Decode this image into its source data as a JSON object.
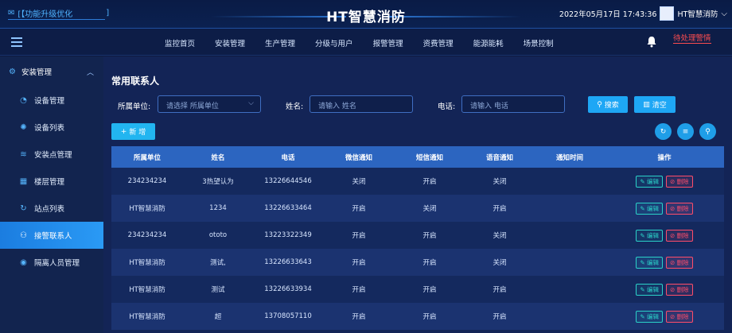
{
  "header": {
    "notice": "[【功能升级优化",
    "notice_bracket": "]",
    "title": "HT智慧消防",
    "datetime": "2022年05月17日 17:43:36",
    "user": "HT智慧消防"
  },
  "nav": {
    "items": [
      "监控首页",
      "安装管理",
      "生产管理",
      "分级与用户",
      "报警管理",
      "资费管理",
      "能源能耗",
      "场景控制"
    ],
    "alarm_link": "待处理警情"
  },
  "sidebar": {
    "group": "安装管理",
    "items": [
      {
        "label": "设备管理",
        "icon": "circle-icon"
      },
      {
        "label": "设备列表",
        "icon": "gear-icon"
      },
      {
        "label": "安装点管理",
        "icon": "layers-icon"
      },
      {
        "label": "楼层管理",
        "icon": "building-icon"
      },
      {
        "label": "站点列表",
        "icon": "refresh-icon"
      },
      {
        "label": "接警联系人",
        "icon": "user-icon"
      },
      {
        "label": "隔离人员管理",
        "icon": "eye-icon"
      }
    ],
    "active_index": 5
  },
  "main": {
    "title": "常用联系人",
    "filters": {
      "unit_label": "所属单位:",
      "unit_placeholder": "请选择 所属单位",
      "name_label": "姓名:",
      "name_placeholder": "请输入 姓名",
      "phone_label": "电话:",
      "phone_placeholder": "请输入 电话",
      "search_btn": "搜索",
      "clear_btn": "清空"
    },
    "add_btn": "新 增",
    "table": {
      "columns": [
        "所属单位",
        "姓名",
        "电话",
        "微信通知",
        "短信通知",
        "语音通知",
        "通知时间",
        "操作"
      ],
      "rows": [
        [
          "234234234",
          "3热望认为",
          "13226644546",
          "关闭",
          "开启",
          "关闭",
          ""
        ],
        [
          "HT智慧消防",
          "1234",
          "13226633464",
          "开启",
          "关闭",
          "开启",
          ""
        ],
        [
          "234234234",
          "ototo",
          "13223322349",
          "开启",
          "开启",
          "关闭",
          ""
        ],
        [
          "HT智慧消防",
          "测试,",
          "13226633643",
          "开启",
          "开启",
          "关闭",
          ""
        ],
        [
          "HT智慧消防",
          "测试",
          "13226633934",
          "开启",
          "开启",
          "开启",
          ""
        ],
        [
          "HT智慧消防",
          "超",
          "13708057110",
          "开启",
          "开启",
          "开启",
          ""
        ]
      ],
      "edit_label": "编辑",
      "delete_label": "删除"
    }
  }
}
